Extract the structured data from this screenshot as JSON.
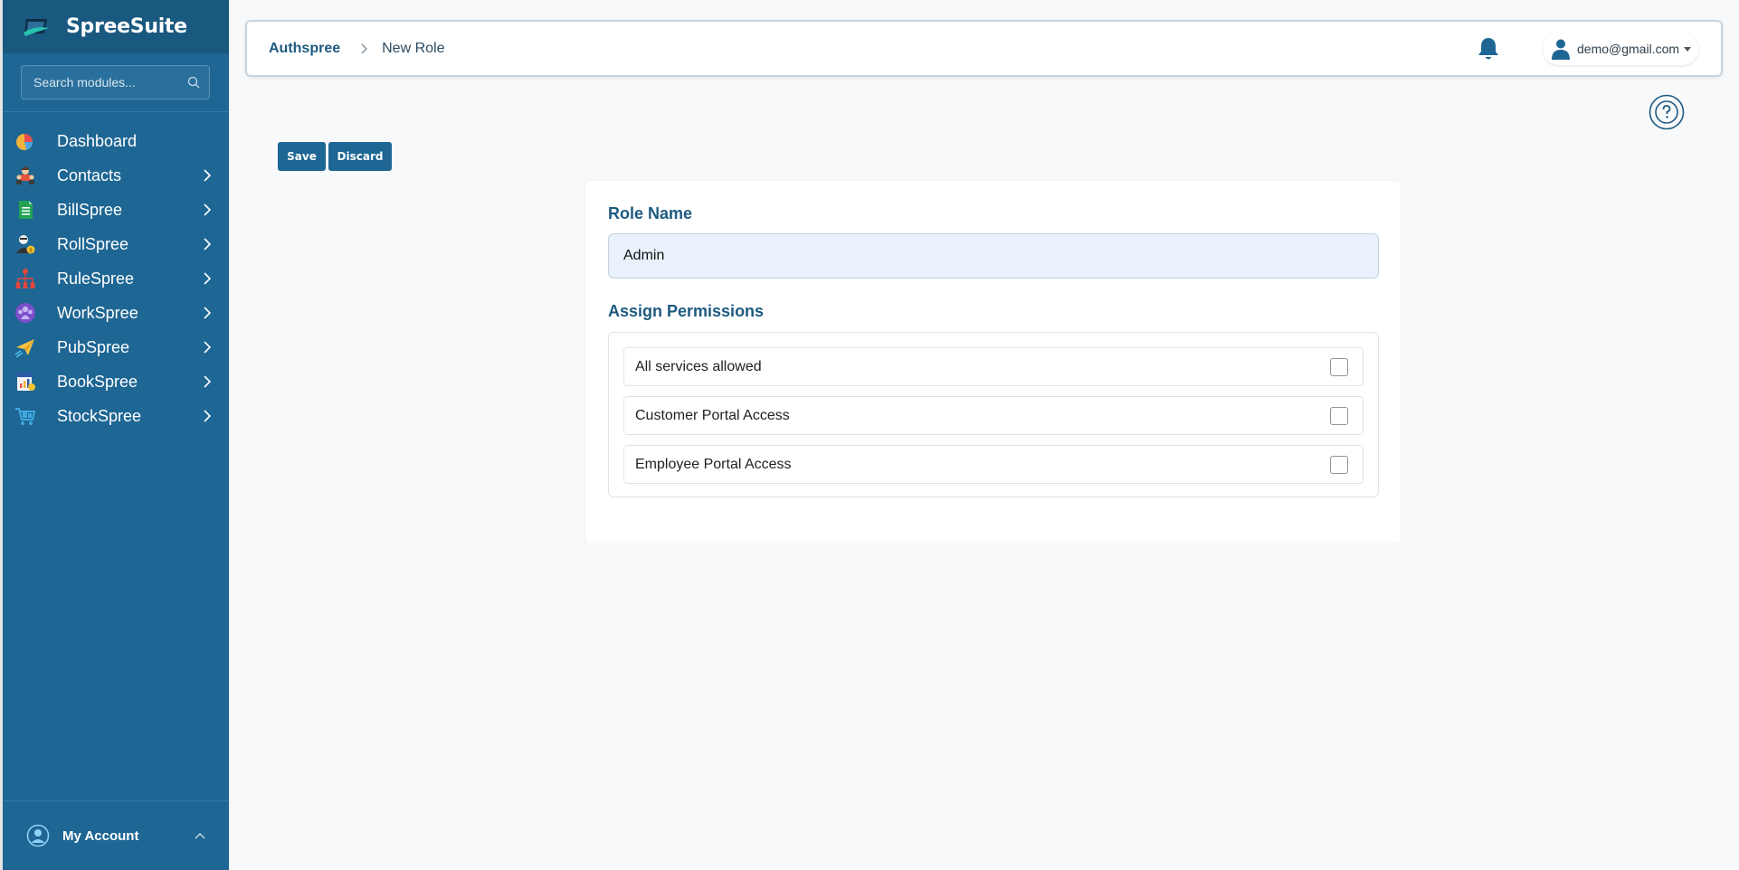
{
  "app": {
    "name": "SpreeSuite"
  },
  "sidebar": {
    "search_placeholder": "Search modules...",
    "items": [
      {
        "label": "Dashboard",
        "icon": "pie-chart-icon",
        "has_submenu": false
      },
      {
        "label": "Contacts",
        "icon": "contacts-icon",
        "has_submenu": true
      },
      {
        "label": "BillSpree",
        "icon": "invoice-icon",
        "has_submenu": true
      },
      {
        "label": "RollSpree",
        "icon": "payroll-icon",
        "has_submenu": true
      },
      {
        "label": "RuleSpree",
        "icon": "org-chart-icon",
        "has_submenu": true
      },
      {
        "label": "WorkSpree",
        "icon": "team-icon",
        "has_submenu": true
      },
      {
        "label": "PubSpree",
        "icon": "paper-plane-icon",
        "has_submenu": true
      },
      {
        "label": "BookSpree",
        "icon": "ledger-icon",
        "has_submenu": true
      },
      {
        "label": "StockSpree",
        "icon": "cart-icon",
        "has_submenu": true
      }
    ],
    "account_label": "My Account"
  },
  "header": {
    "breadcrumb_root": "Authspree",
    "breadcrumb_current": "New Role",
    "user_email": "demo@gmail.com"
  },
  "actions": {
    "save_label": "Save",
    "discard_label": "Discard"
  },
  "form": {
    "role_name_label": "Role Name",
    "role_name_value": "Admin",
    "permissions_label": "Assign Permissions",
    "permissions": [
      {
        "label": "All services allowed",
        "checked": false
      },
      {
        "label": "Customer Portal Access",
        "checked": false
      },
      {
        "label": "Employee Portal Access",
        "checked": false
      }
    ]
  },
  "colors": {
    "sidebar_bg": "#1e6693",
    "brand_bg": "#19587f",
    "accent": "#1e5a80",
    "input_bg": "#e8f1fc"
  }
}
